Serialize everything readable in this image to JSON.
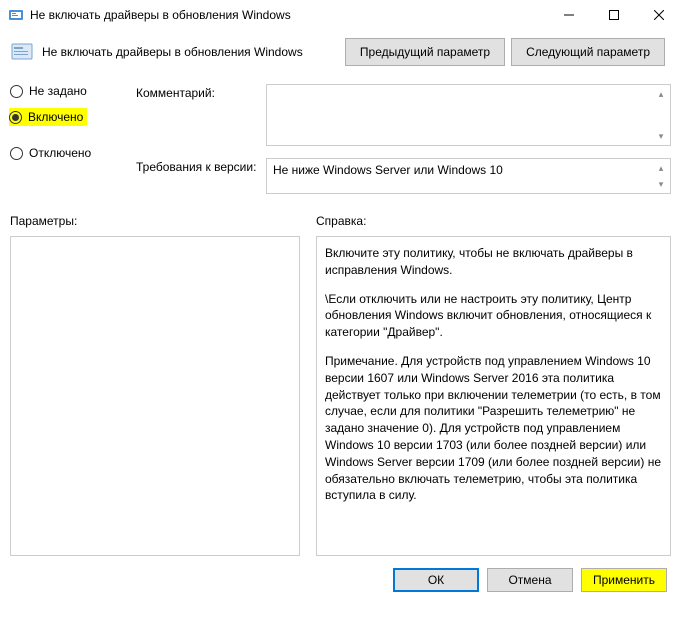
{
  "window": {
    "title": "Не включать драйверы в обновления Windows"
  },
  "subheader": {
    "title": "Не включать драйверы в обновления Windows"
  },
  "nav": {
    "prev": "Предыдущий параметр",
    "next": "Следующий параметр"
  },
  "radios": {
    "not_configured": "Не задано",
    "enabled": "Включено",
    "disabled": "Отключено"
  },
  "fields": {
    "comment_label": "Комментарий:",
    "comment_value": "",
    "version_label": "Требования к версии:",
    "version_value": "Не ниже Windows Server или Windows 10"
  },
  "panels": {
    "params_label": "Параметры:",
    "help_label": "Справка:"
  },
  "help": {
    "p1": "Включите эту политику, чтобы не включать драйверы в исправления Windows.",
    "p2": "\\Если отключить или не настроить эту политику, Центр обновления Windows включит обновления, относящиеся к категории \"Драйвер\".",
    "p3": "Примечание. Для устройств под управлением Windows 10 версии 1607 или Windows Server 2016 эта политика действует только при включении телеметрии (то есть, в том случае, если для политики \"Разрешить телеметрию\" не задано значение 0). Для устройств под управлением Windows 10 версии 1703 (или более поздней версии) или Windows Server версии 1709 (или более поздней версии) не обязательно включать телеметрию, чтобы эта политика вступила в силу."
  },
  "footer": {
    "ok": "ОК",
    "cancel": "Отмена",
    "apply": "Применить"
  }
}
